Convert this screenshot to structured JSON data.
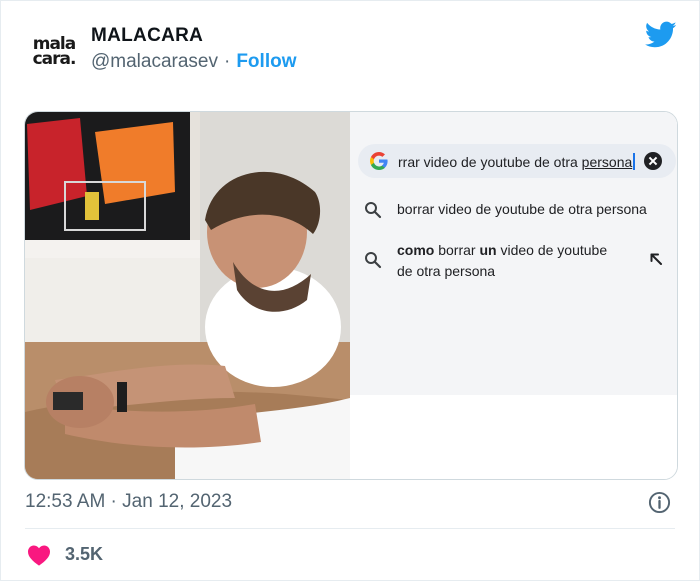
{
  "author": {
    "avatar_line1": "mala",
    "avatar_line2": "cara.",
    "display_name": "MALACARA",
    "handle": "@malacarasev",
    "separator": "·",
    "follow_label": "Follow"
  },
  "icons": {
    "brand": "twitter-bird-icon",
    "search_engine": "google-g-icon",
    "clear": "close-circle-icon",
    "suggestion": "search-icon",
    "insert": "arrow-up-left-icon",
    "info": "info-icon",
    "like": "heart-icon"
  },
  "colors": {
    "twitter_blue": "#1d9bf0",
    "like_pink": "#f91880",
    "muted": "#536471"
  },
  "search": {
    "query_prefix": "rrar video de youtube de otra ",
    "query_underlined": "persona"
  },
  "suggestions": [
    {
      "text": "borrar video de youtube de otra persona"
    },
    {
      "part1_bold": "como",
      "part2": " borrar ",
      "part3_bold": "un",
      "part4": " video de youtube de otra persona"
    }
  ],
  "footer": {
    "timestamp": "12:53 AM · Jan 12, 2023",
    "like_count": "3.5K"
  }
}
